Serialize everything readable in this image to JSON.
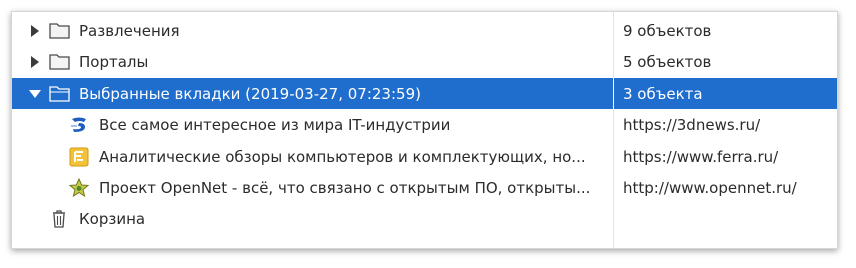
{
  "rows": [
    {
      "label": "Развлечения",
      "info": "9 объектов"
    },
    {
      "label": "Порталы",
      "info": "5 объектов"
    },
    {
      "label": "Выбранные вкладки (2019-03-27, 07:23:59)",
      "info": "3 объекта"
    },
    {
      "label": "Все самое интересное из мира IT-индустрии",
      "info": "https://3dnews.ru/"
    },
    {
      "label": "Аналитические обзоры компьютеров и комплектующих, но...",
      "info": "https://www.ferra.ru/"
    },
    {
      "label": "Проект OpenNet - всё, что связано с открытым ПО, открыты...",
      "info": "http://www.opennet.ru/"
    },
    {
      "label": "Корзина",
      "info": ""
    }
  ],
  "icons": {
    "row0": "folder-icon",
    "row1": "folder-icon",
    "row2": "folder-open-icon",
    "row3": "3dnews-favicon-icon",
    "row4": "ferra-favicon-icon",
    "row5": "opennet-favicon-icon",
    "row6": "trash-icon"
  },
  "colors": {
    "selection": "#1f6dcc",
    "text": "#2b2b2b"
  }
}
